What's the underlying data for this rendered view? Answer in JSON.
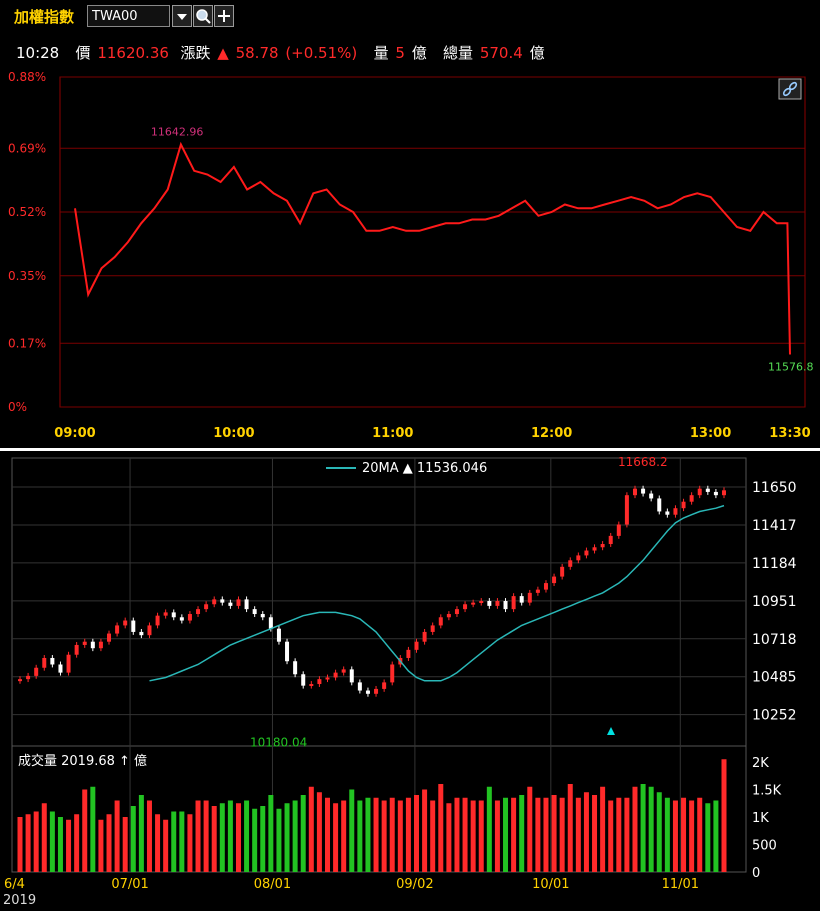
{
  "header": {
    "title": "加權指數",
    "code_value": "TWA00",
    "dropdown_icon": "chevron-down-icon",
    "search_icon": "search-icon",
    "add_icon": "plus-icon"
  },
  "quote": {
    "time": "10:28",
    "price_label": "價",
    "price": "11620.36",
    "change_label": "漲跌",
    "change_arrow": "▲",
    "change": "58.78",
    "change_pct": "(+0.51%)",
    "volume_label": "量",
    "volume": "5",
    "volume_unit": "億",
    "total_label": "總量",
    "total": "570.4",
    "total_unit": "億"
  },
  "colors": {
    "up": "#ff2a2a",
    "down": "#22c322",
    "ma": "#2ab7b7",
    "label_high": "#d0307a"
  },
  "chart_data": [
    {
      "type": "line",
      "title": "",
      "x_ticks": [
        "09:00",
        "10:00",
        "11:00",
        "12:00",
        "13:00",
        "13:30"
      ],
      "y_ticks": [
        "0.88%",
        "0.69%",
        "0.52%",
        "0.35%",
        "0.17%",
        "0%"
      ],
      "ylim": [
        0,
        0.88
      ],
      "grid": true,
      "annotations": {
        "high": "11642.96",
        "last": "11576.8"
      },
      "series": [
        {
          "x": [
            "09:00",
            "09:05",
            "09:10",
            "09:15",
            "09:20",
            "09:25",
            "09:30",
            "09:35",
            "09:40",
            "09:45",
            "09:50",
            "09:55",
            "10:00",
            "10:05",
            "10:10",
            "10:15",
            "10:20",
            "10:25",
            "10:30",
            "10:35",
            "10:40",
            "10:45",
            "10:50",
            "10:55",
            "11:00",
            "11:05",
            "11:10",
            "11:15",
            "11:20",
            "11:25",
            "11:30",
            "11:35",
            "11:40",
            "11:45",
            "11:50",
            "11:55",
            "12:00",
            "12:05",
            "12:10",
            "12:15",
            "12:20",
            "12:25",
            "12:30",
            "12:35",
            "12:40",
            "12:45",
            "12:50",
            "12:55",
            "13:00",
            "13:05",
            "13:10",
            "13:15",
            "13:20",
            "13:25",
            "13:29",
            "13:30"
          ],
          "values": [
            0.53,
            0.3,
            0.37,
            0.4,
            0.44,
            0.49,
            0.53,
            0.58,
            0.7,
            0.63,
            0.62,
            0.6,
            0.64,
            0.58,
            0.6,
            0.57,
            0.55,
            0.49,
            0.57,
            0.58,
            0.54,
            0.52,
            0.47,
            0.47,
            0.48,
            0.47,
            0.47,
            0.48,
            0.49,
            0.49,
            0.5,
            0.5,
            0.51,
            0.53,
            0.55,
            0.51,
            0.52,
            0.54,
            0.53,
            0.53,
            0.54,
            0.55,
            0.56,
            0.55,
            0.53,
            0.54,
            0.56,
            0.57,
            0.56,
            0.52,
            0.48,
            0.47,
            0.52,
            0.49,
            0.49,
            0.14
          ]
        }
      ]
    },
    {
      "type": "candlestick",
      "title": "",
      "legend": {
        "name": "20MA",
        "arrow": "▲",
        "value": "11536.046"
      },
      "x_ticks": [
        "6/4",
        "07/01",
        "08/01",
        "09/02",
        "10/01",
        "11/01"
      ],
      "year_label": "2019",
      "y_ticks": [
        "11650",
        "11417",
        "11184",
        "10951",
        "10718",
        "10485",
        "10252"
      ],
      "ylim": [
        10090,
        11810
      ],
      "annotations": {
        "high": "11668.2",
        "low": "10180.04"
      },
      "closes": [
        10470,
        10490,
        10540,
        10600,
        10560,
        10510,
        10620,
        10680,
        10700,
        10660,
        10700,
        10750,
        10800,
        10830,
        10760,
        10740,
        10800,
        10860,
        10880,
        10850,
        10830,
        10870,
        10900,
        10930,
        10960,
        10940,
        10920,
        10960,
        10900,
        10870,
        10850,
        10780,
        10700,
        10580,
        10500,
        10430,
        10440,
        10470,
        10480,
        10510,
        10530,
        10450,
        10400,
        10380,
        10410,
        10450,
        10560,
        10600,
        10650,
        10700,
        10760,
        10800,
        10850,
        10870,
        10900,
        10930,
        10940,
        10950,
        10920,
        10950,
        10900,
        10980,
        10940,
        11000,
        11020,
        11060,
        11100,
        11160,
        11200,
        11230,
        11260,
        11280,
        11300,
        11350,
        11420,
        11600,
        11640,
        11610,
        11580,
        11500,
        11480,
        11520,
        11560,
        11600,
        11640,
        11620,
        11600,
        11630
      ],
      "ma20": [
        10460,
        10470,
        10480,
        10500,
        10520,
        10540,
        10560,
        10590,
        10620,
        10650,
        10680,
        10700,
        10720,
        10740,
        10760,
        10780,
        10800,
        10820,
        10840,
        10860,
        10870,
        10880,
        10880,
        10880,
        10870,
        10860,
        10840,
        10800,
        10760,
        10700,
        10640,
        10580,
        10520,
        10480,
        10460,
        10460,
        10460,
        10480,
        10510,
        10550,
        10590,
        10630,
        10670,
        10710,
        10740,
        10770,
        10800,
        10820,
        10840,
        10860,
        10880,
        10900,
        10920,
        10940,
        10960,
        10980,
        11000,
        11030,
        11060,
        11100,
        11150,
        11200,
        11260,
        11320,
        11380,
        11430,
        11460,
        11480,
        11500,
        11510,
        11520,
        11536
      ],
      "volume": {
        "label": "成交量",
        "value": "2019.68",
        "arrow": "↑",
        "unit": "億",
        "y_ticks": [
          "2K",
          "1.5K",
          "1K",
          "500",
          "0"
        ],
        "ylim": [
          0,
          2200
        ],
        "values": [
          1000,
          1050,
          1100,
          1250,
          1100,
          1000,
          950,
          1050,
          1500,
          1550,
          950,
          1050,
          1300,
          1000,
          1200,
          1400,
          1300,
          1050,
          950,
          1100,
          1100,
          1050,
          1300,
          1300,
          1200,
          1250,
          1300,
          1250,
          1300,
          1150,
          1200,
          1400,
          1150,
          1250,
          1300,
          1400,
          1550,
          1450,
          1350,
          1250,
          1300,
          1500,
          1300,
          1350,
          1350,
          1300,
          1350,
          1300,
          1350,
          1400,
          1500,
          1300,
          1600,
          1250,
          1350,
          1350,
          1300,
          1300,
          1550,
          1300,
          1350,
          1350,
          1400,
          1550,
          1350,
          1350,
          1400,
          1350,
          1600,
          1350,
          1450,
          1400,
          1550,
          1300,
          1350,
          1350,
          1550,
          1600,
          1550,
          1450,
          1350,
          1300,
          1350,
          1300,
          1350,
          1250,
          1300,
          2050
        ]
      }
    }
  ]
}
